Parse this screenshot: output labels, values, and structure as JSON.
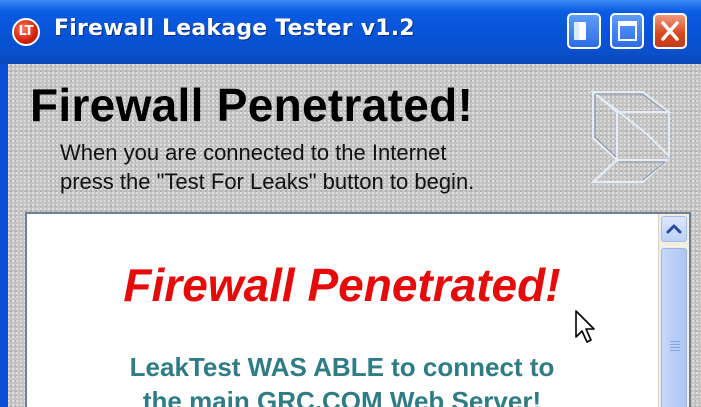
{
  "window": {
    "title": "Firewall Leakage Tester  v1.2",
    "app_icon_text": "LT",
    "titlebar_color": "#0653d6"
  },
  "header": {
    "heading": "Firewall Penetrated!",
    "instructions_line1": "When you are connected to the Internet",
    "instructions_line2": "press the \"Test For Leaks\" button to begin.",
    "logo_icon": "grc-logo-icon"
  },
  "result_panel": {
    "headline": "Firewall Penetrated!",
    "headline_color": "#e50b0b",
    "message_line1": "LeakTest WAS ABLE to connect to",
    "message_line2": "the main GRC.COM Web Server!",
    "message_color": "#2f7c85"
  },
  "icons": {
    "minimize": "minimize-icon",
    "maximize": "maximize-icon",
    "close": "close-icon",
    "scroll_up": "chevron-up-icon",
    "cursor": "mouse-pointer-icon"
  }
}
